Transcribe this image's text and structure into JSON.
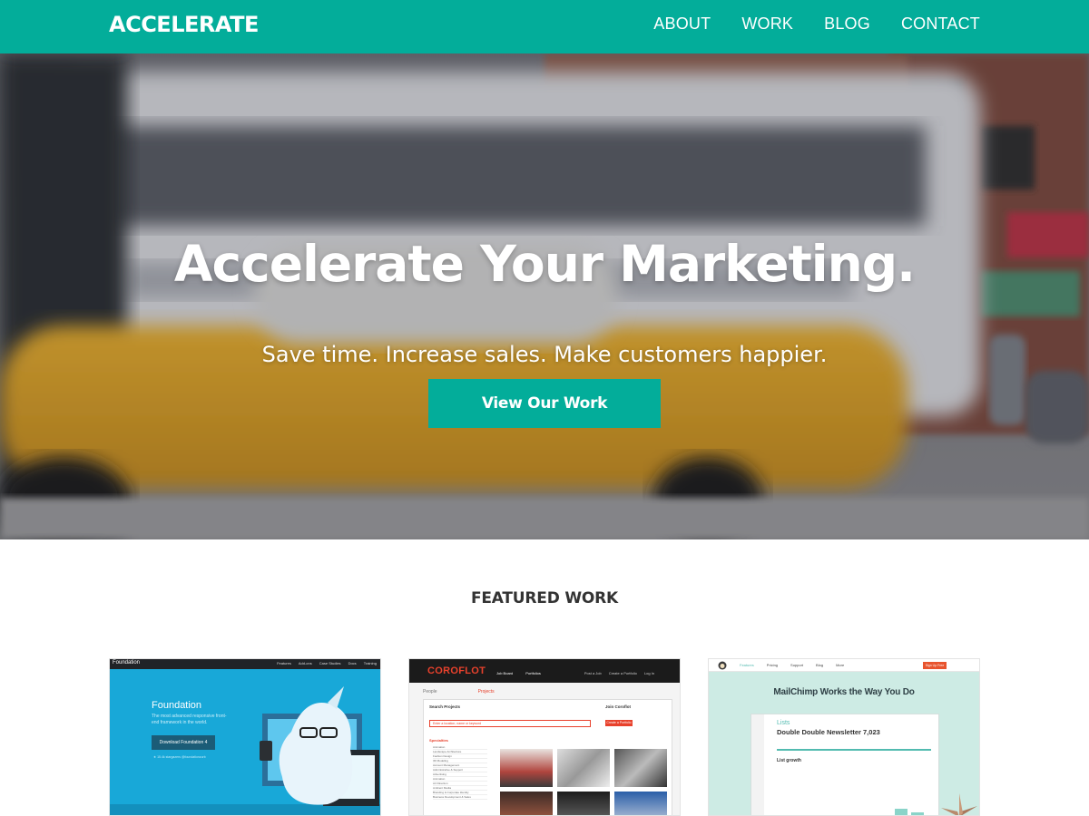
{
  "header": {
    "logo": "ACCELERATE",
    "nav": [
      "ABOUT",
      "WORK",
      "BLOG",
      "CONTACT"
    ]
  },
  "hero": {
    "title": "Accelerate Your Marketing.",
    "subtitle": "Save time. Increase sales. Make customers happier.",
    "cta_label": "View Our Work"
  },
  "featured": {
    "title": "FEATURED WORK",
    "cards": [
      {
        "name": "foundation",
        "brand": "Foundation",
        "menu": [
          "Features",
          "Add-ons",
          "Case Studies",
          "Docs",
          "Training"
        ],
        "headline": "Foundation",
        "tagline": "The most advanced responsive front-end framework in the world.",
        "button": "Download Foundation 4",
        "links": "★ 15.4k stargazers   @foundationzurb"
      },
      {
        "name": "coroflot",
        "logo": "COROFLOT",
        "menu": [
          "Job Board",
          "Portfolios"
        ],
        "right_menu": [
          "Post a Job",
          "Create a Portfolio",
          "Log In"
        ],
        "tabs": [
          "People",
          "Projects"
        ],
        "search_label": "Search Projects",
        "search_placeholder": "Enter a location, name or keyword",
        "join_label": "Join Coroflot",
        "join_button": "Create a Portfolio",
        "specialties_label": "Specialties",
        "specialties": [
          "Animation",
          "Landscape Architecture",
          "Fashion Design",
          "3D Modeling",
          "Account Management",
          "Administrative & Support",
          "Advertising",
          "Animation",
          "Art Direction",
          "Ambient Media",
          "Branding & Corporate Identity",
          "Business Development & Sales"
        ]
      },
      {
        "name": "mailchimp",
        "menu": [
          "Features",
          "Pricing",
          "Support",
          "Blog",
          "More"
        ],
        "cta": "Sign Up Free",
        "headline": "MailChimp Works the Way You Do",
        "lists_label": "Lists",
        "newsletter": "Double Double Newsletter 7,023",
        "growth_label": "List growth"
      }
    ]
  },
  "colors": {
    "accent": "#03ad9a",
    "text_dark": "#333333",
    "coroflot_red": "#e8412c",
    "foundation_blue": "#18a8d8",
    "mailchimp_mint": "#cdebe4"
  }
}
